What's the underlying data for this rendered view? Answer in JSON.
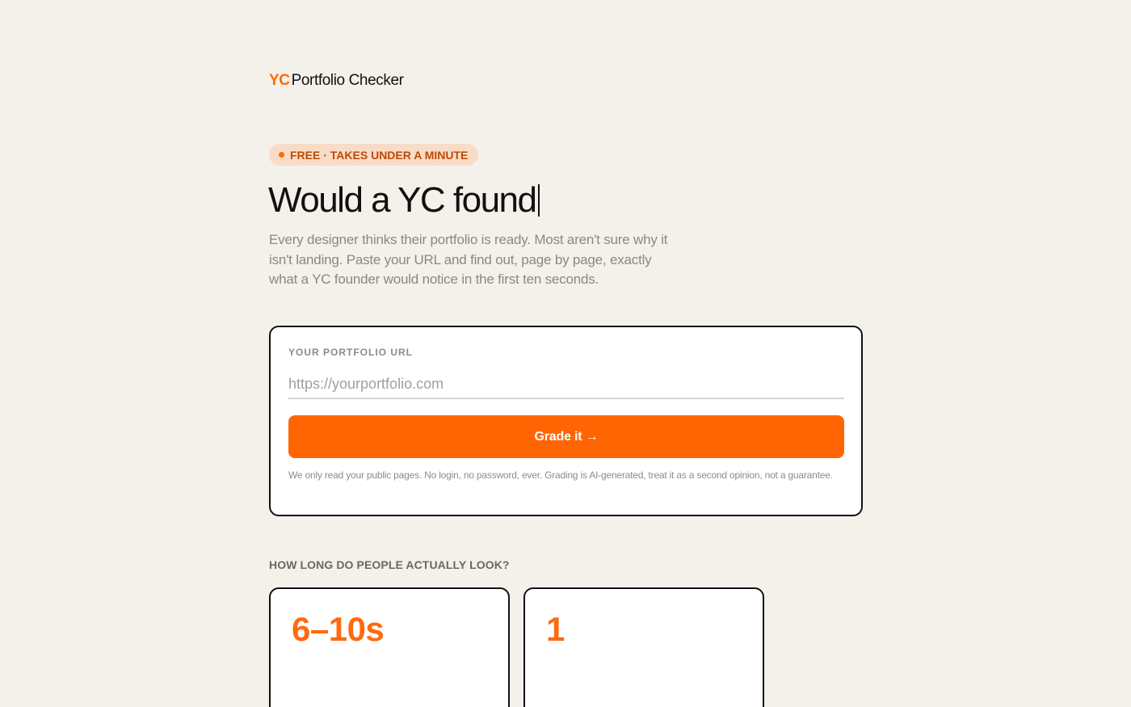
{
  "brand": {
    "mark": "YC",
    "name": "Portfolio Checker"
  },
  "hero": {
    "badge": "FREE · TAKES UNDER A MINUTE",
    "headline": "Would a YC found",
    "subtitle": "Every designer thinks their portfolio is ready. Most aren't sure why it isn't landing. Paste your URL and find out, page by page, exactly what a YC founder would notice in the first ten seconds."
  },
  "form": {
    "label": "YOUR PORTFOLIO URL",
    "value": "",
    "placeholder": "https://yourportfolio.com",
    "button_label": "Grade it →",
    "disclaimer": "We only read your public pages. No login, no password, ever. Grading is AI-generated, treat it as a second opinion, not a guarantee."
  },
  "stats": {
    "heading": "HOW LONG DO PEOPLE ACTUALLY LOOK?",
    "items": [
      {
        "value": "6–10s"
      },
      {
        "value": "1"
      }
    ]
  },
  "colors": {
    "accent": "#ff6603",
    "background": "#f4f1eb",
    "badge_bg": "#f8dcc8",
    "badge_text": "#c04a00"
  }
}
